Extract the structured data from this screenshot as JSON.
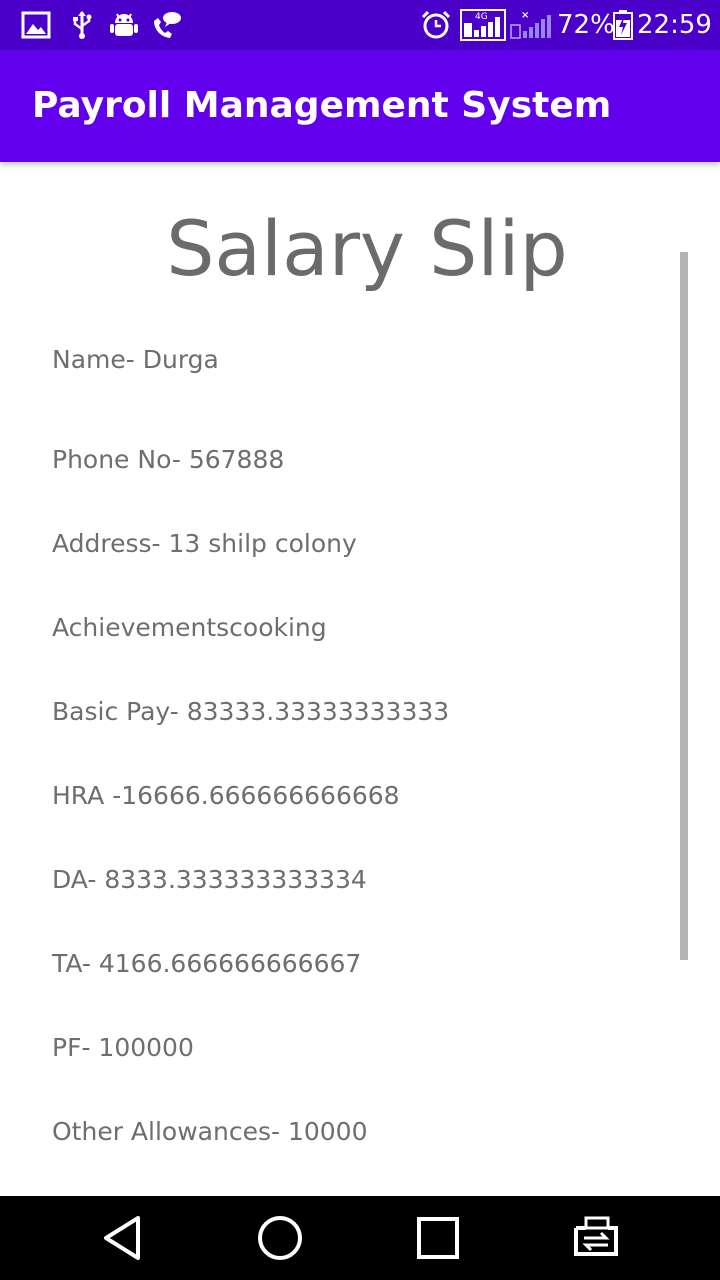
{
  "status_bar": {
    "icons": [
      "image-icon",
      "usb-icon",
      "android-debug-icon",
      "chat-bubble-icon",
      "alarm-icon",
      "signal-4g-sim1-icon",
      "signal-sim2-icon",
      "battery-charging-icon"
    ],
    "network_label": "4G",
    "battery_percent": "72%",
    "time": "22:59",
    "background_color": "#4a00c8"
  },
  "app_bar": {
    "title": "Payroll Management System",
    "color": "#6200ee"
  },
  "slip": {
    "title": "Salary Slip",
    "fields": [
      "Name- Durga",
      "Phone No- 567888",
      "Address- 13 shilp colony",
      "Achievementscooking",
      "Basic Pay- 83333.33333333333",
      "HRA -16666.666666666668",
      "DA- 8333.333333333334",
      "TA- 4166.666666666667",
      "PF- 100000",
      "Other Allowances- 10000"
    ]
  },
  "nav_bar": {
    "buttons": [
      "back-icon",
      "home-icon",
      "recents-icon",
      "switch-apps-icon"
    ]
  }
}
